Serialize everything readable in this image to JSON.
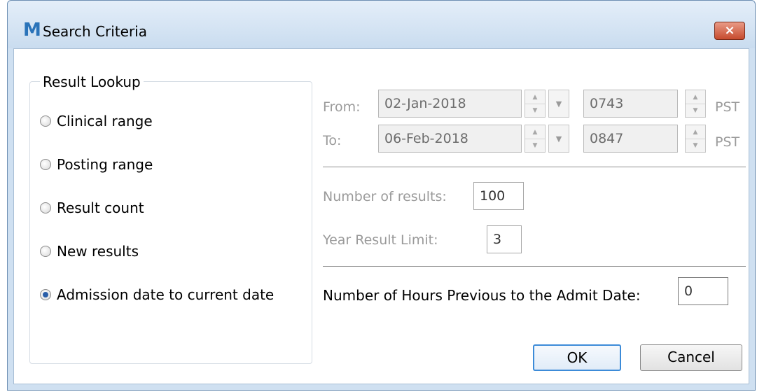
{
  "window": {
    "app_icon": "M",
    "title": "Search Criteria",
    "close_symbol": "×"
  },
  "result_lookup": {
    "group_label": "Result Lookup",
    "options": [
      {
        "label": "Clinical range",
        "checked": false
      },
      {
        "label": "Posting range",
        "checked": false
      },
      {
        "label": "Result count",
        "checked": false
      },
      {
        "label": "New results",
        "checked": false
      },
      {
        "label": "Admission date to current date",
        "checked": true
      }
    ]
  },
  "range": {
    "from_label": "From:",
    "from_date": "02-Jan-2018",
    "from_time": "0743",
    "from_tz": "PST",
    "to_label": "To:",
    "to_date": "06-Feb-2018",
    "to_time": "0847",
    "to_tz": "PST"
  },
  "counts": {
    "number_label": "Number of results:",
    "number_value": "100",
    "year_label": "Year Result Limit:",
    "year_value": "3"
  },
  "admit": {
    "label": "Number of Hours Previous to the Admit Date:",
    "value": "0"
  },
  "buttons": {
    "ok": "OK",
    "cancel": "Cancel"
  },
  "icons": {
    "spin_up": "▲",
    "spin_down": "▼",
    "dropdown": "▼"
  }
}
